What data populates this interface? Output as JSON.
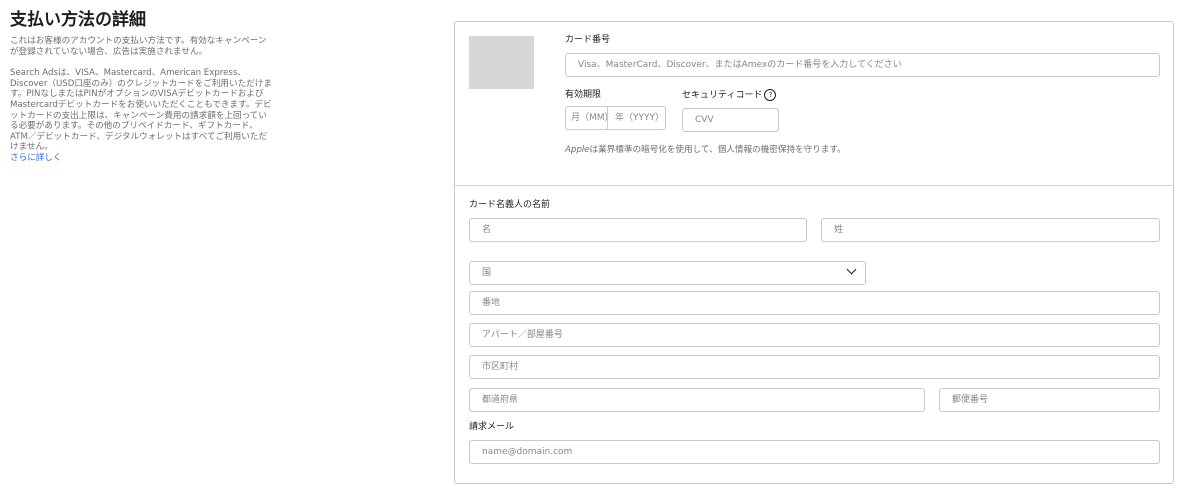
{
  "left": {
    "title": "支払い方法の詳細",
    "intro": "これはお客様のアカウントの支払い方法です。有効なキャンペーンが登録されていない場合、広告は実施されません。",
    "body": "Search Adsは、VISA、Mastercard、American Express、Discover（USD口座のみ）のクレジットカードをご利用いただけます。PINなしまたはPINがオプションのVISAデビットカードおよびMastercardデビットカードをお使いいただくこともできます。デビットカードの支出上限は、キャンペーン費用の請求額を上回っている必要があります。その他のプリペイドカード、ギフトカード、ATM／デビットカード、デジタルウォレットはすべてご利用いただけません。",
    "link": "さらに詳しく"
  },
  "card": {
    "number_label": "カード番号",
    "number_placeholder": "Visa、MasterCard、Discover、またはAmexのカード番号を入力してください",
    "expiry_label": "有効期限",
    "month_placeholder": "月（MM）",
    "year_placeholder": "年（YYYY）",
    "cvv_label": "セキュリティコード",
    "cvv_help_icon": "?",
    "cvv_placeholder": "CVV",
    "note_brand": "Apple",
    "note_text": "は業界標準の暗号化を使用して、個人情報の機密保持を守ります。"
  },
  "billing": {
    "holder_label": "カード名義人の名前",
    "first_name_placeholder": "名",
    "last_name_placeholder": "姓",
    "country_placeholder": "国",
    "address_placeholder": "番地",
    "apt_placeholder": "アパート／部屋番号",
    "city_placeholder": "市区町村",
    "state_placeholder": "都道府県",
    "zip_placeholder": "郵便番号",
    "email_label": "請求メール",
    "email_placeholder": "name@domain.com"
  }
}
